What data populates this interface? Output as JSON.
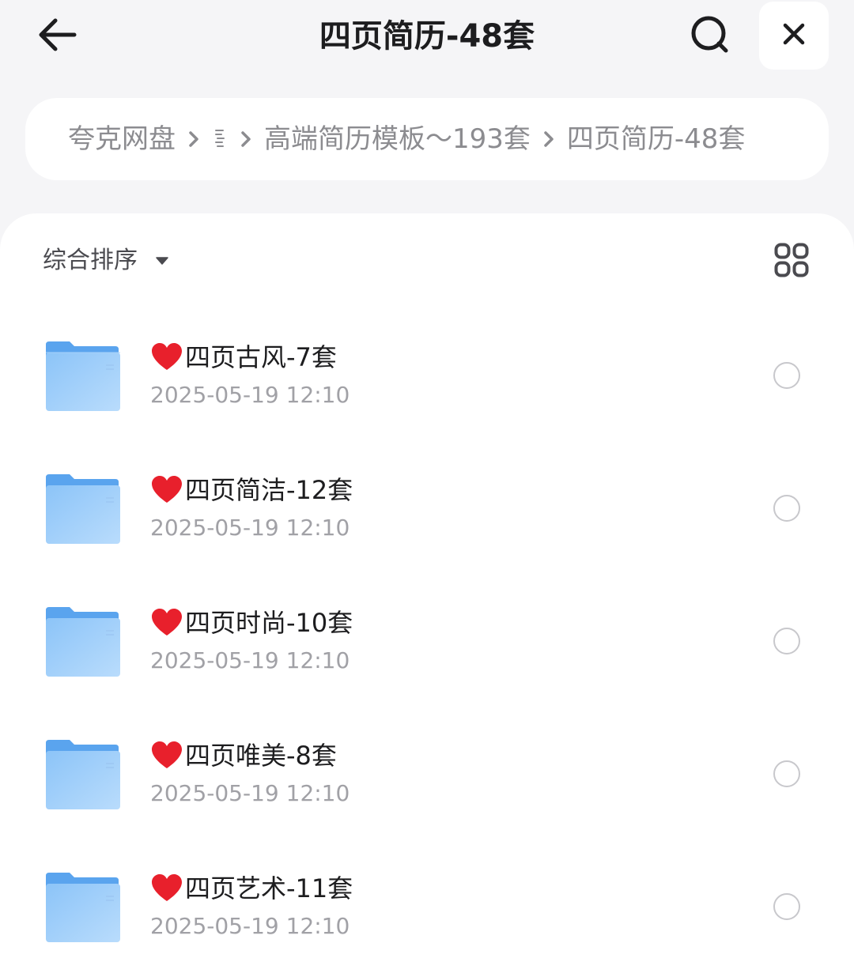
{
  "header": {
    "title": "四页简历-48套",
    "back_icon": "arrow-left-icon",
    "search_icon": "search-icon",
    "close_icon": "close-icon"
  },
  "breadcrumb": {
    "items": [
      "夸克网盘",
      "高端简历模板～193套",
      "四页简历-48套"
    ],
    "separator_icon": "chevron-right-icon",
    "collapsed_icon": "collapsed-path-icon"
  },
  "toolbar": {
    "sort_label": "综合排序",
    "sort_caret_icon": "caret-down-icon",
    "view_toggle_icon": "grid-view-icon"
  },
  "files": [
    {
      "name": "四页古风-7套",
      "date": "2025-05-19 12:10",
      "icon": "folder-icon",
      "prefix_icon": "heart-icon"
    },
    {
      "name": "四页简洁-12套",
      "date": "2025-05-19 12:10",
      "icon": "folder-icon",
      "prefix_icon": "heart-icon"
    },
    {
      "name": "四页时尚-10套",
      "date": "2025-05-19 12:10",
      "icon": "folder-icon",
      "prefix_icon": "heart-icon"
    },
    {
      "name": "四页唯美-8套",
      "date": "2025-05-19 12:10",
      "icon": "folder-icon",
      "prefix_icon": "heart-icon"
    },
    {
      "name": "四页艺术-11套",
      "date": "2025-05-19 12:10",
      "icon": "folder-icon",
      "prefix_icon": "heart-icon"
    }
  ],
  "colors": {
    "background": "#f5f5f7",
    "panel": "#ffffff",
    "text_primary": "#1d1d1f",
    "text_secondary": "#a1a1a6",
    "folder_blue": "#7ab8f5",
    "heart_red": "#e8202c"
  }
}
